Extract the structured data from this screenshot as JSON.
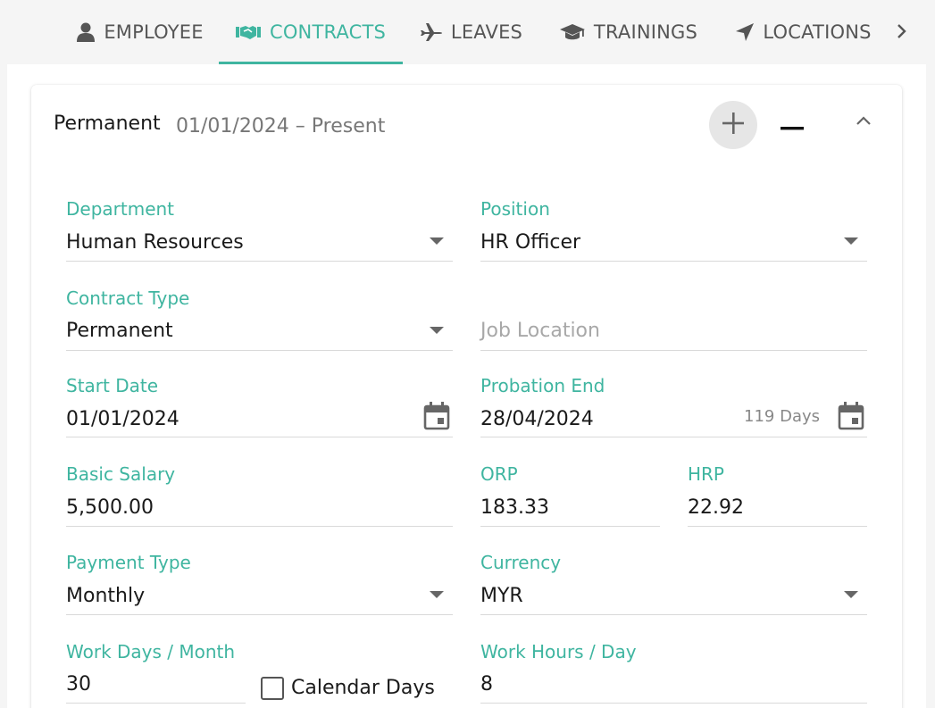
{
  "tabs": [
    {
      "label": "EMPLOYEE",
      "icon": "user-icon",
      "active": false
    },
    {
      "label": "CONTRACTS",
      "icon": "handshake-icon",
      "active": true
    },
    {
      "label": "LEAVES",
      "icon": "plane-icon",
      "active": false
    },
    {
      "label": "TRAININGS",
      "icon": "graduation-cap-icon",
      "active": false
    },
    {
      "label": "LOCATIONS",
      "icon": "location-arrow-icon",
      "active": false
    }
  ],
  "colors": {
    "accent": "#3fb5a0",
    "icon": "#555555"
  },
  "contract": {
    "title": "Permanent",
    "period": "01/01/2024 – Present",
    "fields": {
      "department": {
        "label": "Department",
        "value": "Human Resources"
      },
      "position": {
        "label": "Position",
        "value": "HR Officer"
      },
      "contract_type": {
        "label": "Contract Type",
        "value": "Permanent"
      },
      "job_location": {
        "placeholder": "Job Location"
      },
      "start_date": {
        "label": "Start Date",
        "value": "01/01/2024"
      },
      "probation_end": {
        "label": "Probation End",
        "value": "28/04/2024",
        "days": "119 Days"
      },
      "basic_salary": {
        "label": "Basic Salary",
        "value": "5,500.00"
      },
      "orp": {
        "label": "ORP",
        "value": "183.33"
      },
      "hrp": {
        "label": "HRP",
        "value": "22.92"
      },
      "payment_type": {
        "label": "Payment Type",
        "value": "Monthly"
      },
      "currency": {
        "label": "Currency",
        "value": "MYR"
      },
      "work_days": {
        "label": "Work Days / Month",
        "value": "30"
      },
      "calendar_days": {
        "label": "Calendar Days",
        "checked": false
      },
      "work_hours": {
        "label": "Work Hours / Day",
        "value": "8"
      }
    }
  }
}
